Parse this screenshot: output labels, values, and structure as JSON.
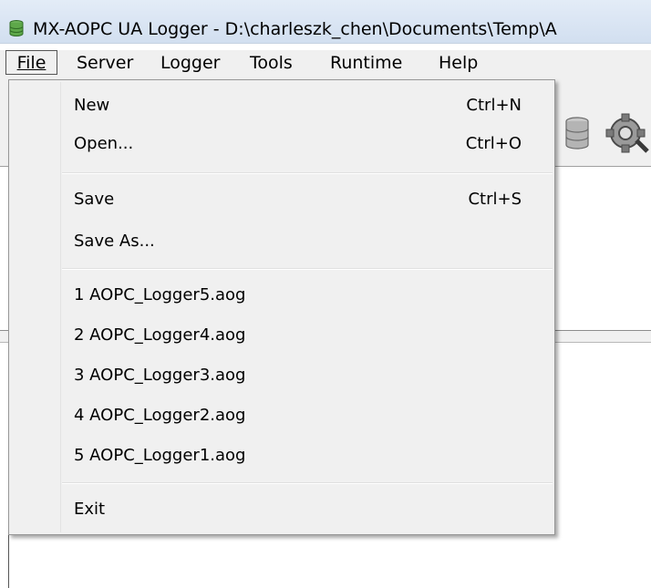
{
  "window": {
    "title": "MX-AOPC UA Logger - D:\\charleszk_chen\\Documents\\Temp\\A"
  },
  "menubar": {
    "items": [
      "File",
      "Server",
      "Logger",
      "Tools",
      "Runtime",
      "Help"
    ]
  },
  "file_menu": {
    "items": [
      {
        "label": "New",
        "shortcut": "Ctrl+N"
      },
      {
        "label": "Open...",
        "shortcut": "Ctrl+O"
      },
      {
        "label": "Save",
        "shortcut": "Ctrl+S"
      },
      {
        "label": "Save As..."
      },
      {
        "label": "1 AOPC_Logger5.aog"
      },
      {
        "label": "2 AOPC_Logger4.aog"
      },
      {
        "label": "3 AOPC_Logger3.aog"
      },
      {
        "label": "4 AOPC_Logger2.aog"
      },
      {
        "label": "5 AOPC_Logger1.aog"
      },
      {
        "label": "Exit"
      }
    ]
  },
  "toolbar": {
    "icons": [
      "database-icon",
      "gear-icon"
    ]
  },
  "colors": {
    "menu_background": "#f0f0f0",
    "titlebar": "#dde8f4",
    "app_icon": "#4e9c3e"
  }
}
